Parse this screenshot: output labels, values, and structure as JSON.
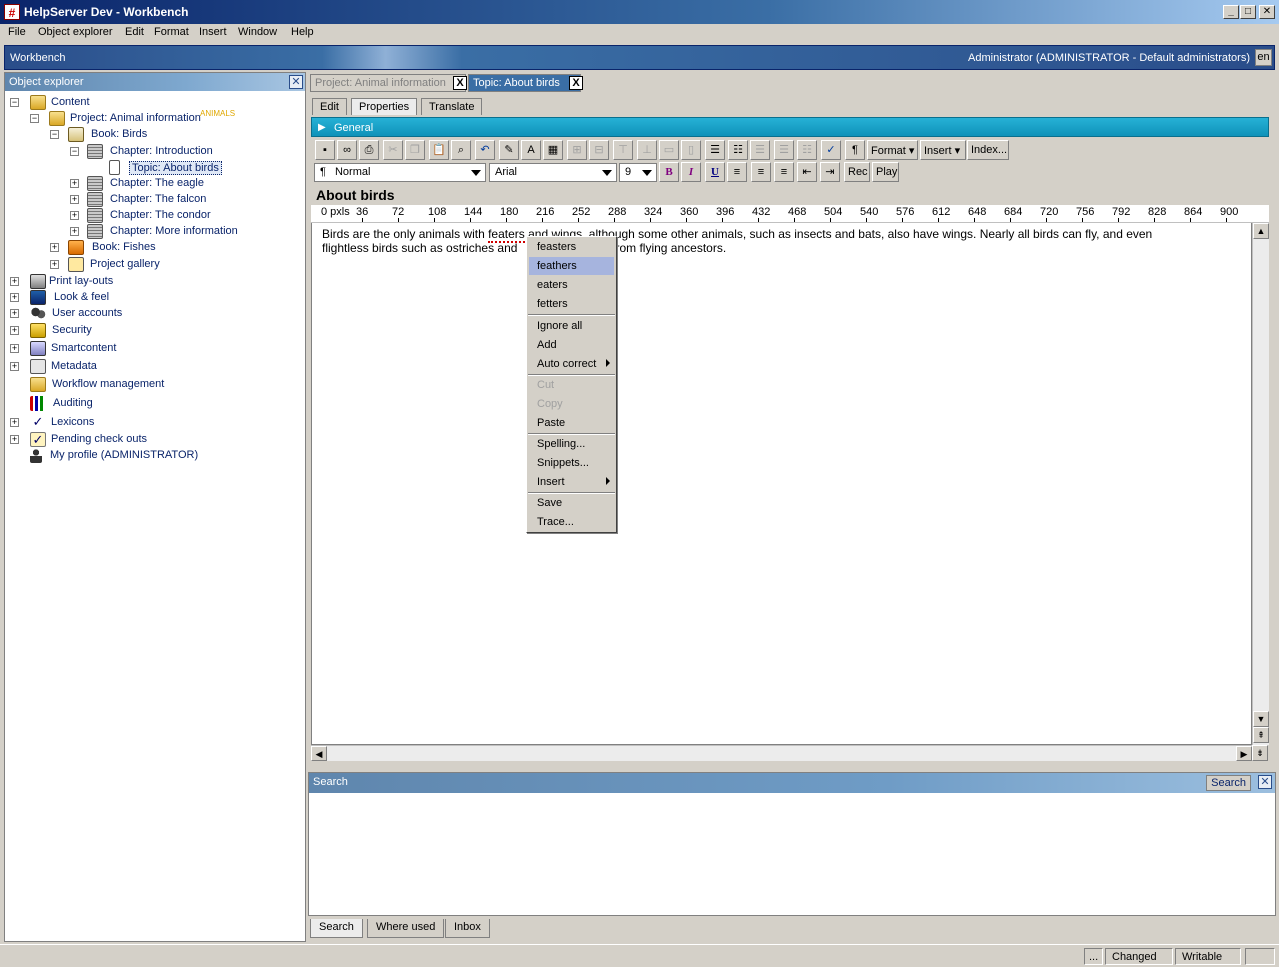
{
  "window": {
    "title": "HelpServer Dev - Workbench",
    "app_icon": "#"
  },
  "menu": [
    "File",
    "Object explorer",
    "Edit",
    "Format",
    "Insert",
    "Window",
    "Help"
  ],
  "banner": {
    "left": "Workbench",
    "right": "Administrator (ADMINISTRATOR - Default administrators)",
    "lang": "en"
  },
  "explorer": {
    "title": "Object explorer",
    "items": [
      {
        "label": "Content",
        "icon": "folder-icon"
      },
      {
        "label": "Project: Animal information",
        "badge": "ANIMALS",
        "icon": "project-folder-icon"
      },
      {
        "label": "Book: Birds",
        "icon": "book-icon"
      },
      {
        "label": "Chapter: Introduction",
        "icon": "chapter-icon"
      },
      {
        "label": "Topic: About birds",
        "icon": "topic-page-icon"
      },
      {
        "label": "Chapter: The eagle",
        "icon": "chapter-icon"
      },
      {
        "label": "Chapter: The falcon",
        "icon": "chapter-icon"
      },
      {
        "label": "Chapter: The condor",
        "icon": "chapter-icon"
      },
      {
        "label": "Chapter: More information",
        "icon": "chapter-icon"
      },
      {
        "label": "Book: Fishes",
        "icon": "book-icon"
      },
      {
        "label": "Project gallery",
        "icon": "gallery-icon"
      },
      {
        "label": "Print lay-outs",
        "icon": "printer-icon"
      },
      {
        "label": "Look & feel",
        "icon": "monitor-icon"
      },
      {
        "label": "User accounts",
        "icon": "users-icon"
      },
      {
        "label": "Security",
        "icon": "lock-icon"
      },
      {
        "label": "Smartcontent",
        "icon": "smartcontent-icon"
      },
      {
        "label": "Metadata",
        "icon": "metadata-icon"
      },
      {
        "label": "Workflow management",
        "icon": "workflow-icon"
      },
      {
        "label": "Auditing",
        "icon": "chart-icon"
      },
      {
        "label": "Lexicons",
        "icon": "spellcheck-icon"
      },
      {
        "label": "Pending check outs",
        "icon": "checkout-icon"
      },
      {
        "label": "My profile (ADMINISTRATOR)",
        "icon": "person-icon"
      }
    ]
  },
  "doc_tabs": [
    {
      "label": "Project: Animal information",
      "close": "X"
    },
    {
      "label": "Topic: About birds",
      "close": "X"
    }
  ],
  "sub_tabs": [
    "Edit",
    "Properties",
    "Translate"
  ],
  "section": "General",
  "toolbar": {
    "format_label": "Format",
    "insert_label": "Insert",
    "index_label": "Index...",
    "style": "Normal",
    "font": "Arial",
    "size": "9",
    "bold": "B",
    "italic": "I",
    "underline": "U",
    "rec": "Rec",
    "play": "Play",
    "pilcrow": "¶"
  },
  "document": {
    "title": "About birds",
    "ruler_unit": "0 pxls",
    "ruler": [
      "36",
      "72",
      "108",
      "144",
      "180",
      "216",
      "252",
      "288",
      "324",
      "360",
      "396",
      "432",
      "468",
      "504",
      "540",
      "576",
      "612",
      "648",
      "684",
      "720",
      "756",
      "792",
      "828",
      "864",
      "900"
    ],
    "text_before": "Birds are the only animals with ",
    "misspelled": "featers",
    "text_after_line1": " and wings, although some other animals, such as insects and bats, also have wings. Nearly all birds can fly, and even",
    "text_line2_a": "flightless birds such as ostriches and",
    "text_line2_b": "ed from flying ancestors."
  },
  "context_menu": {
    "suggestions": [
      "feasters",
      "feathers",
      "eaters",
      "fetters"
    ],
    "highlighted": "feathers",
    "group2": [
      "Ignore all",
      "Add",
      "Auto correct"
    ],
    "group3": [
      "Cut",
      "Copy",
      "Paste"
    ],
    "group4": [
      "Spelling...",
      "Snippets...",
      "Insert"
    ],
    "group5": [
      "Save",
      "Trace..."
    ]
  },
  "search_panel": {
    "title": "Search",
    "button": "Search"
  },
  "bottom_tabs": [
    "Search",
    "Where used",
    "Inbox"
  ],
  "status": {
    "more": "...",
    "changed": "Changed",
    "writable": "Writable"
  }
}
